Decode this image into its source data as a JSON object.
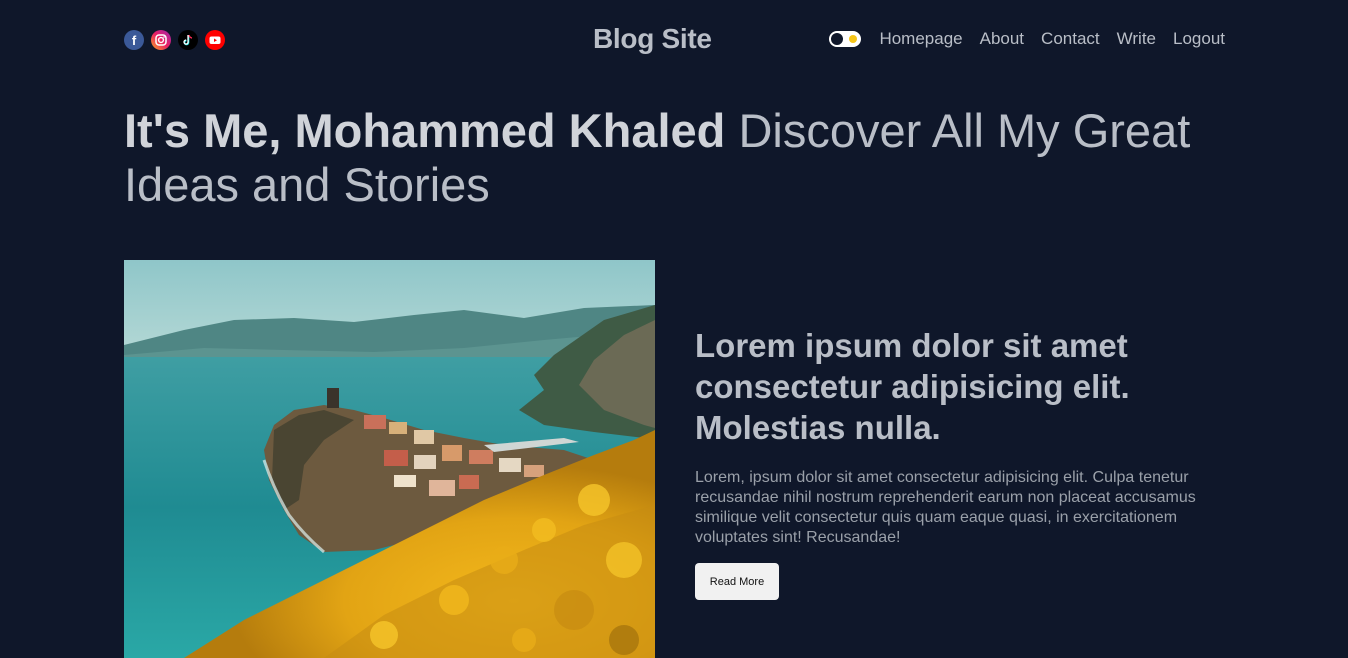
{
  "navbar": {
    "social_icons": [
      "facebook-icon",
      "instagram-icon",
      "tiktok-icon",
      "youtube-icon"
    ],
    "logo": "Blog Site",
    "links": [
      "Homepage",
      "About",
      "Contact",
      "Write",
      "Logout"
    ],
    "theme_toggle": "dark"
  },
  "hero": {
    "title_strong": "It's Me, Mohammed Khaled",
    "title_rest": " Discover All My Great Ideas and Stories"
  },
  "featured": {
    "image": "coastal-village-landscape",
    "title": "Lorem ipsum dolor sit amet consectetur adipisicing elit. Molestias nulla.",
    "description": "Lorem, ipsum dolor sit amet consectetur adipisicing elit. Culpa tenetur recusandae nihil nostrum reprehenderit earum non placeat accusamus similique velit consectetur quis quam eaque quasi, in exercitationem voluptates sint! Recusandae!",
    "button": "Read More"
  },
  "colors": {
    "background": "#0f172a",
    "text": "#b9bec7",
    "facebook": "#1877f2",
    "youtube": "#ff0000",
    "toggle_sun": "#f5c518"
  }
}
